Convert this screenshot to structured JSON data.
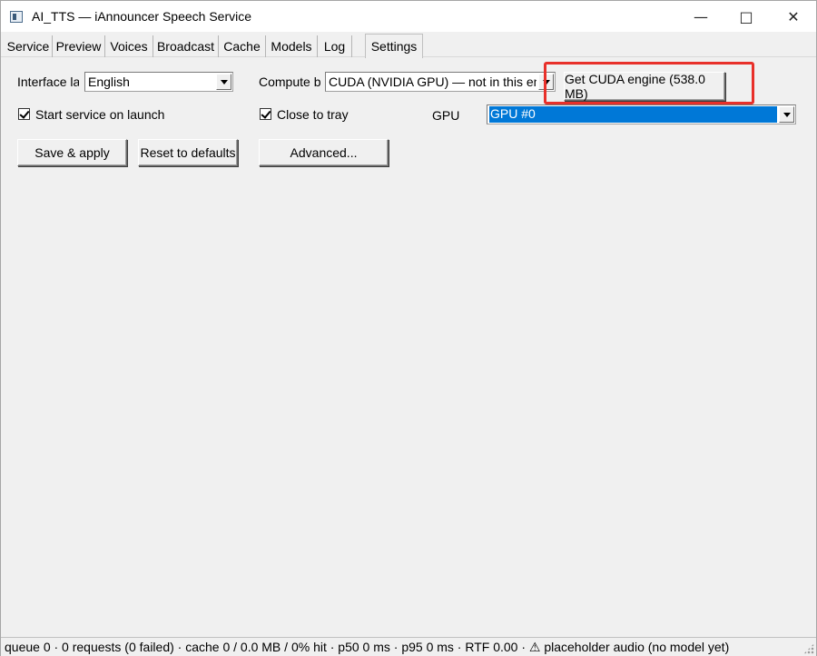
{
  "window": {
    "title": "AI_TTS — iAnnouncer Speech Service",
    "minimize_glyph": "—",
    "maximize_glyph": "□",
    "close_glyph": "✕"
  },
  "tabs": [
    {
      "label": "Service"
    },
    {
      "label": "Preview"
    },
    {
      "label": "Voices"
    },
    {
      "label": "Broadcast"
    },
    {
      "label": "Cache"
    },
    {
      "label": "Models"
    },
    {
      "label": "Log"
    },
    {
      "label": "Settings",
      "active": true
    }
  ],
  "settings": {
    "interface_language_label": "Interface lan",
    "interface_language_value": "English",
    "compute_backend_label": "Compute b",
    "compute_backend_value": "CUDA (NVIDIA GPU) — not in this engi",
    "get_cuda_button": "Get CUDA engine (538.0 MB)",
    "start_on_launch_label": "Start service on launch",
    "start_on_launch_checked": true,
    "close_to_tray_label": "Close to tray",
    "close_to_tray_checked": true,
    "gpu_label": "GPU",
    "gpu_value": "GPU #0",
    "save_apply_button": "Save & apply",
    "reset_defaults_button": "Reset to defaults",
    "advanced_button": "Advanced..."
  },
  "status": {
    "text": "queue 0 · 0 requests (0 failed) · cache 0 / 0.0 MB / 0% hit · p50 0 ms · p95 0 ms · RTF 0.00 · ⚠ placeholder audio (no model yet)"
  },
  "colors": {
    "highlight_box": "#e8302a",
    "selection": "#0078d7"
  }
}
